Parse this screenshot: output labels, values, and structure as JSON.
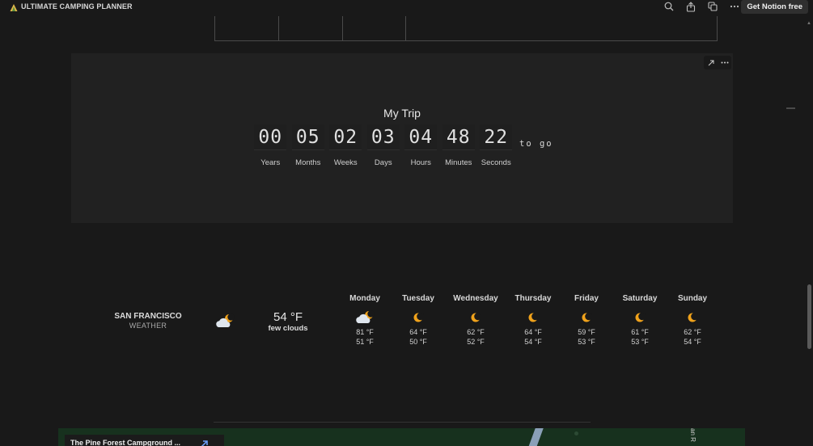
{
  "app": {
    "title": "ULTIMATE CAMPING PLANNER"
  },
  "topbar": {
    "icons": [
      "search-icon",
      "share-icon",
      "duplicate-icon",
      "more-icon"
    ],
    "cta_label": "Get Notion free"
  },
  "countdown": {
    "title": "My Trip",
    "units": [
      {
        "value": "00",
        "label": "Years"
      },
      {
        "value": "05",
        "label": "Months"
      },
      {
        "value": "02",
        "label": "Weeks"
      },
      {
        "value": "03",
        "label": "Days"
      },
      {
        "value": "04",
        "label": "Hours"
      },
      {
        "value": "48",
        "label": "Minutes"
      },
      {
        "value": "22",
        "label": "Seconds"
      }
    ],
    "suffix": "to go"
  },
  "weather": {
    "city": "SAN FRANCISCO",
    "subtitle": "WEATHER",
    "current_temp": "54 °F",
    "current_desc": "few clouds",
    "current_icon": "cloud-moon-icon",
    "forecast": [
      {
        "day": "Monday",
        "icon": "cloud-moon-icon",
        "hi": "81 °F",
        "lo": "51 °F"
      },
      {
        "day": "Tuesday",
        "icon": "moon-icon",
        "hi": "64 °F",
        "lo": "50 °F"
      },
      {
        "day": "Wednesday",
        "icon": "moon-icon",
        "hi": "62 °F",
        "lo": "52 °F"
      },
      {
        "day": "Thursday",
        "icon": "moon-icon",
        "hi": "64 °F",
        "lo": "54 °F"
      },
      {
        "day": "Friday",
        "icon": "moon-icon",
        "hi": "59 °F",
        "lo": "53 °F"
      },
      {
        "day": "Saturday",
        "icon": "moon-icon",
        "hi": "61 °F",
        "lo": "53 °F"
      },
      {
        "day": "Sunday",
        "icon": "moon-icon",
        "hi": "62 °F",
        "lo": "54 °F"
      }
    ]
  },
  "map": {
    "card_title": "The Pine Forest Campground ...",
    "side_label": "an R"
  },
  "colors": {
    "background": "#191919",
    "embed": "#212121",
    "moon": "#f0a21b",
    "link": "#6c9ef8"
  }
}
